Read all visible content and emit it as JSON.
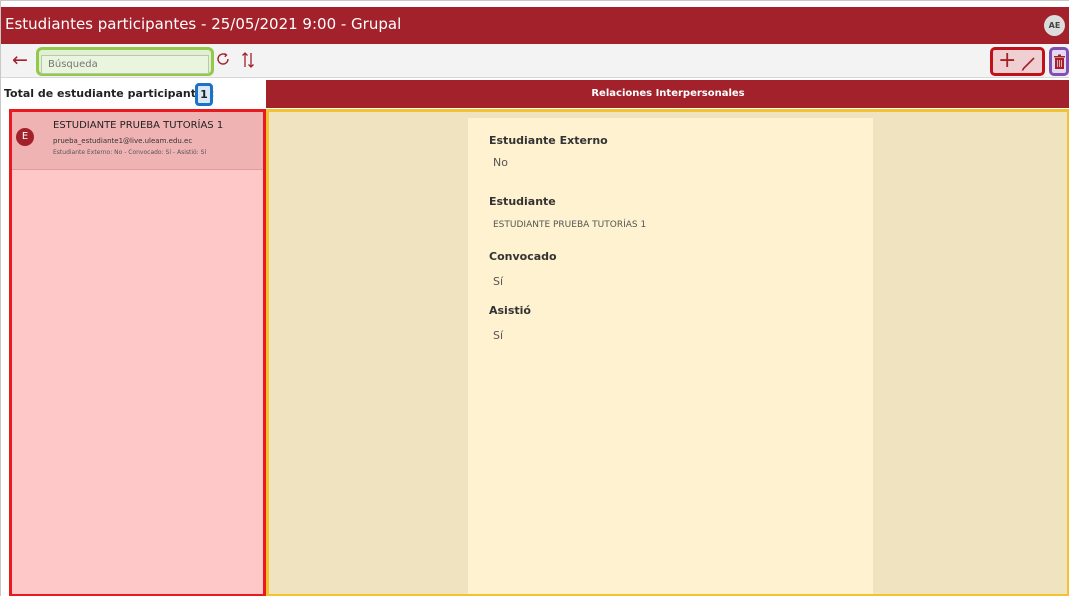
{
  "window": {
    "title": "Estudiantes participantes - 25/05/2021 9:00 - Grupal",
    "user_initials": "AE"
  },
  "toolbar": {
    "search_placeholder": "Búsqueda",
    "back_icon": "arrow-left-icon",
    "refresh_icon": "refresh-icon",
    "sort_icon": "sort-icon",
    "add_icon": "plus-icon",
    "edit_icon": "pencil-icon",
    "delete_icon": "trash-icon"
  },
  "list": {
    "total_label": "Total de estudiante participantes:",
    "count": "1",
    "items": [
      {
        "initial": "E",
        "name": "ESTUDIANTE PRUEBA TUTORÍAS 1",
        "email": "prueba_estudiante1@live.uleam.edu.ec",
        "meta": "Estudiante Externo: No - Convocado: Sí - Asistió: Sí"
      }
    ]
  },
  "detail": {
    "section_title": "Relaciones Interpersonales",
    "fields": [
      {
        "label": "Estudiante Externo",
        "value": "No"
      },
      {
        "label": "Estudiante",
        "value": "ESTUDIANTE PRUEBA TUTORÍAS 1"
      },
      {
        "label": "Convocado",
        "value": "Sí"
      },
      {
        "label": "Asistió",
        "value": "Sí"
      }
    ]
  },
  "colors": {
    "brand": "#a2212b",
    "list_highlight": "#e8191f",
    "detail_highlight": "#f2c230",
    "search_highlight": "#92c94a",
    "count_highlight": "#1a73c9",
    "delete_highlight": "#7f4fb5"
  }
}
